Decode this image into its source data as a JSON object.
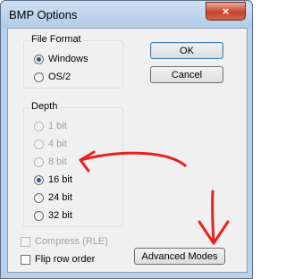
{
  "window": {
    "title": "BMP Options",
    "close_glyph": "×"
  },
  "file_format": {
    "label": "File Format",
    "options": [
      {
        "label": "Windows",
        "checked": true
      },
      {
        "label": "OS/2",
        "checked": false
      }
    ]
  },
  "depth": {
    "label": "Depth",
    "options": [
      {
        "label": "1 bit",
        "enabled": false,
        "checked": false
      },
      {
        "label": "4 bit",
        "enabled": false,
        "checked": false
      },
      {
        "label": "8 bit",
        "enabled": false,
        "checked": false
      },
      {
        "label": "16 bit",
        "enabled": true,
        "checked": true
      },
      {
        "label": "24 bit",
        "enabled": true,
        "checked": false
      },
      {
        "label": "32 bit",
        "enabled": true,
        "checked": false
      }
    ]
  },
  "buttons": {
    "ok": "OK",
    "cancel": "Cancel",
    "advanced": "Advanced Modes"
  },
  "checkboxes": {
    "compress": {
      "label": "Compress (RLE)",
      "enabled": false,
      "checked": false
    },
    "flip": {
      "label": "Flip row order",
      "enabled": true,
      "checked": false
    }
  },
  "annotation_color": "#e8201c"
}
